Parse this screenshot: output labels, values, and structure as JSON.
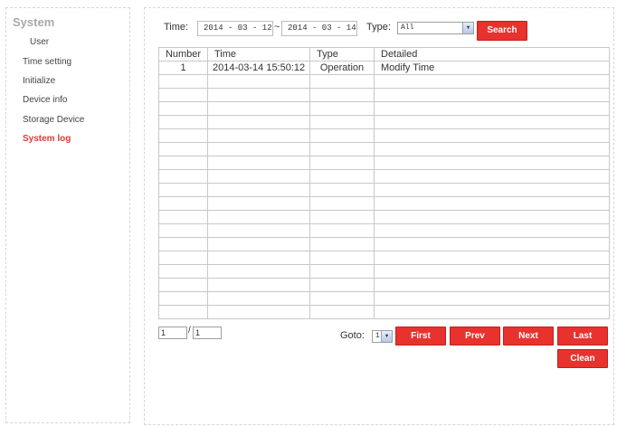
{
  "sidebar": {
    "title": "System",
    "items": [
      {
        "label": "User"
      },
      {
        "label": "Time setting"
      },
      {
        "label": "Initialize"
      },
      {
        "label": "Device info"
      },
      {
        "label": "Storage Device"
      },
      {
        "label": "System log",
        "active": true
      }
    ]
  },
  "filter": {
    "time_label": "Time:",
    "start_date": "2014 - 03 - 12",
    "separator": "~",
    "end_date": "2014 - 03 - 14",
    "type_label": "Type:",
    "type_value": "All",
    "search_label": "Search"
  },
  "table": {
    "headers": [
      "Number",
      "Time",
      "Type",
      "Detailed"
    ],
    "rows": [
      [
        "1",
        "2014-03-14 15:50:12",
        "Operation",
        "Modify Time"
      ],
      [
        "",
        "",
        "",
        ""
      ],
      [
        "",
        "",
        "",
        ""
      ],
      [
        "",
        "",
        "",
        ""
      ],
      [
        "",
        "",
        "",
        ""
      ],
      [
        "",
        "",
        "",
        ""
      ],
      [
        "",
        "",
        "",
        ""
      ],
      [
        "",
        "",
        "",
        ""
      ],
      [
        "",
        "",
        "",
        ""
      ],
      [
        "",
        "",
        "",
        ""
      ],
      [
        "",
        "",
        "",
        ""
      ],
      [
        "",
        "",
        "",
        ""
      ],
      [
        "",
        "",
        "",
        ""
      ],
      [
        "",
        "",
        "",
        ""
      ],
      [
        "",
        "",
        "",
        ""
      ],
      [
        "",
        "",
        "",
        ""
      ],
      [
        "",
        "",
        "",
        ""
      ],
      [
        "",
        "",
        "",
        ""
      ],
      [
        "",
        "",
        "",
        ""
      ]
    ]
  },
  "pagination": {
    "current_page": "1",
    "separator": "/",
    "total_pages": "1",
    "goto_label": "Goto:",
    "goto_value": "1",
    "first_label": "First",
    "prev_label": "Prev",
    "next_label": "Next",
    "last_label": "Last",
    "clean_label": "Clean"
  },
  "colors": {
    "accent": "#e8322e",
    "active_menu": "#e53935"
  }
}
